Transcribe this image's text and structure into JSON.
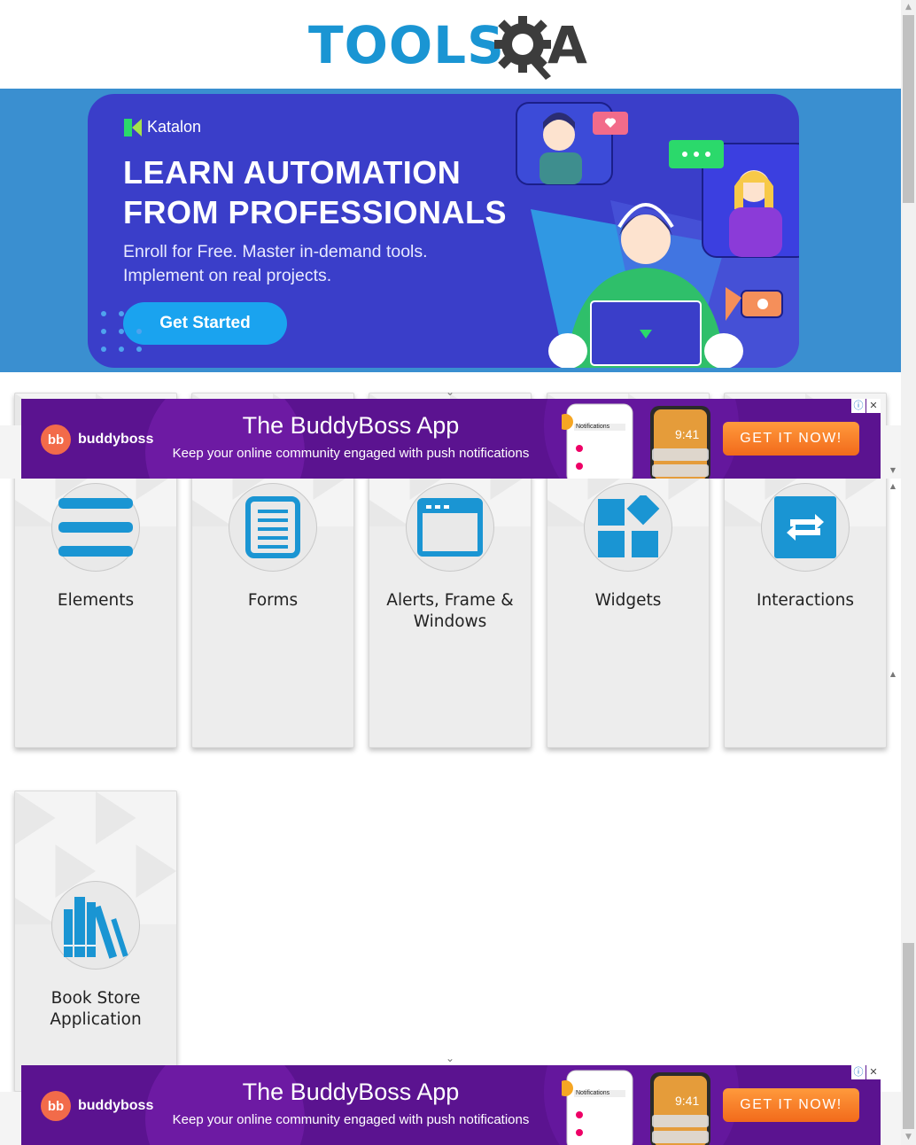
{
  "header": {
    "logo_text": "TOOLS",
    "logo_suffix": "A"
  },
  "banner": {
    "brand": "Katalon",
    "headline_line1": "LEARN AUTOMATION",
    "headline_line2": "FROM PROFESSIONALS",
    "sub_line1": "Enroll for Free. Master in-demand tools.",
    "sub_line2": "Implement on real projects.",
    "cta": "Get Started",
    "accent": "#1aa3ef",
    "background": "#3a3ec9"
  },
  "cards": [
    {
      "title": "Elements",
      "icon": "elements-icon"
    },
    {
      "title": "Forms",
      "icon": "forms-icon"
    },
    {
      "title": "Alerts, Frame & Windows",
      "icon": "window-icon"
    },
    {
      "title": "Widgets",
      "icon": "widgets-icon"
    },
    {
      "title": "Interactions",
      "icon": "interactions-icon"
    },
    {
      "title": "Book Store Application",
      "icon": "books-icon"
    }
  ],
  "ads": [
    {
      "brand": "buddyboss",
      "title": "The BuddyBoss App",
      "subtitle": "Keep your online community engaged with push notifications",
      "button": "GET IT NOW!",
      "phone_time": "9:41",
      "phone_header": "Notifications"
    },
    {
      "brand": "buddyboss",
      "title": "The BuddyBoss App",
      "subtitle": "Keep your online community engaged with push notifications",
      "button": "GET IT NOW!",
      "phone_time": "9:41",
      "phone_header": "Notifications"
    }
  ],
  "colors": {
    "brand_blue": "#1a95d3",
    "icon_blue": "#1a95d3",
    "ad_purple": "#6a1b9a",
    "ad_button": "#f26a1b"
  }
}
